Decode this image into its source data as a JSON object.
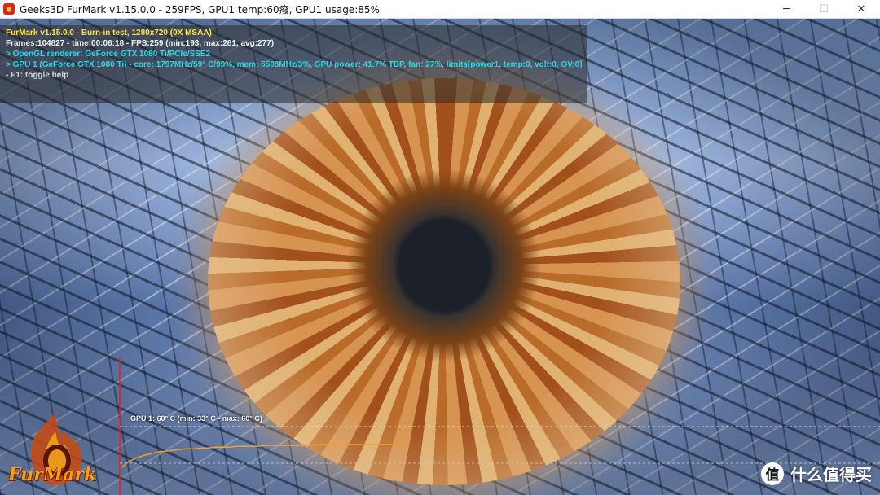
{
  "window": {
    "title": "Geeks3D FurMark v1.15.0.0 - 259FPS, GPU1 temp:60癈, GPU1 usage:85%",
    "controls": {
      "minimize": "─",
      "maximize": "☐",
      "close": "✕"
    }
  },
  "osd": {
    "line1": "FurMark v1.15.0.0 - Burn-in test, 1280x720 (0X MSAA)",
    "line2": "Frames:104827 - time:00:06:18 - FPS:259 (min:193, max:281, avg:277)",
    "line3": "> OpenGL renderer: GeForce GTX 1080 Ti/PCIe/SSE2",
    "line4": "> GPU 1 (GeForce GTX 1080 Ti) - core: 1797MHz/59° C/99%, mem: 5508MHz/3%, GPU power: 41.7% TDP, fan: 27%, limits[power1, temp:0, volt:0, OV:0]",
    "line5": "- F1: toggle help"
  },
  "graph": {
    "label": "GPU 1: 60° C (min: 33° C - max: 60° C)",
    "line_color": "#f0a030",
    "temp_series": [
      33,
      40,
      44,
      47,
      49,
      51,
      52,
      53,
      54,
      55,
      55,
      56,
      56,
      57,
      57,
      57,
      58,
      58,
      58,
      58,
      59,
      59,
      59,
      59,
      59,
      59,
      59,
      60,
      60,
      60,
      60,
      60,
      60,
      60,
      60,
      60,
      60,
      60,
      60,
      60
    ]
  },
  "logo": {
    "text": "FurMark"
  },
  "watermark": {
    "icon": "值",
    "text": "什么值得买"
  },
  "colors": {
    "osd_title": "#ffe24a",
    "osd_info": "#2cd6e8",
    "osd_stats": "#f2f2f2"
  }
}
